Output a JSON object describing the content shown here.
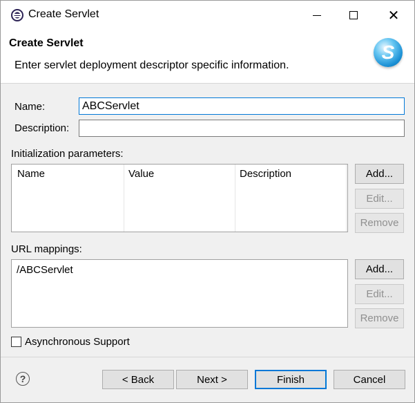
{
  "window": {
    "title": "Create Servlet"
  },
  "banner": {
    "title": "Create Servlet",
    "description": "Enter servlet deployment descriptor specific information."
  },
  "form": {
    "name_label": "Name:",
    "name_value": "ABCServlet",
    "description_label": "Description:",
    "description_value": ""
  },
  "init_params": {
    "label": "Initialization parameters:",
    "columns": [
      "Name",
      "Value",
      "Description"
    ],
    "rows": [],
    "add_label": "Add...",
    "edit_label": "Edit...",
    "remove_label": "Remove"
  },
  "url_mappings": {
    "label": "URL mappings:",
    "items": [
      "/ABCServlet"
    ],
    "add_label": "Add...",
    "edit_label": "Edit...",
    "remove_label": "Remove"
  },
  "async": {
    "label": "Asynchronous Support",
    "checked": false
  },
  "footer": {
    "back_label": "< Back",
    "next_label": "Next >",
    "finish_label": "Finish",
    "cancel_label": "Cancel"
  },
  "icons": {
    "app": "eclipse-icon",
    "banner": "servlet-wizard-icon",
    "help": "help-icon"
  },
  "colors": {
    "focus_border": "#0078d7",
    "banner_icon": "#1a8fd4"
  }
}
